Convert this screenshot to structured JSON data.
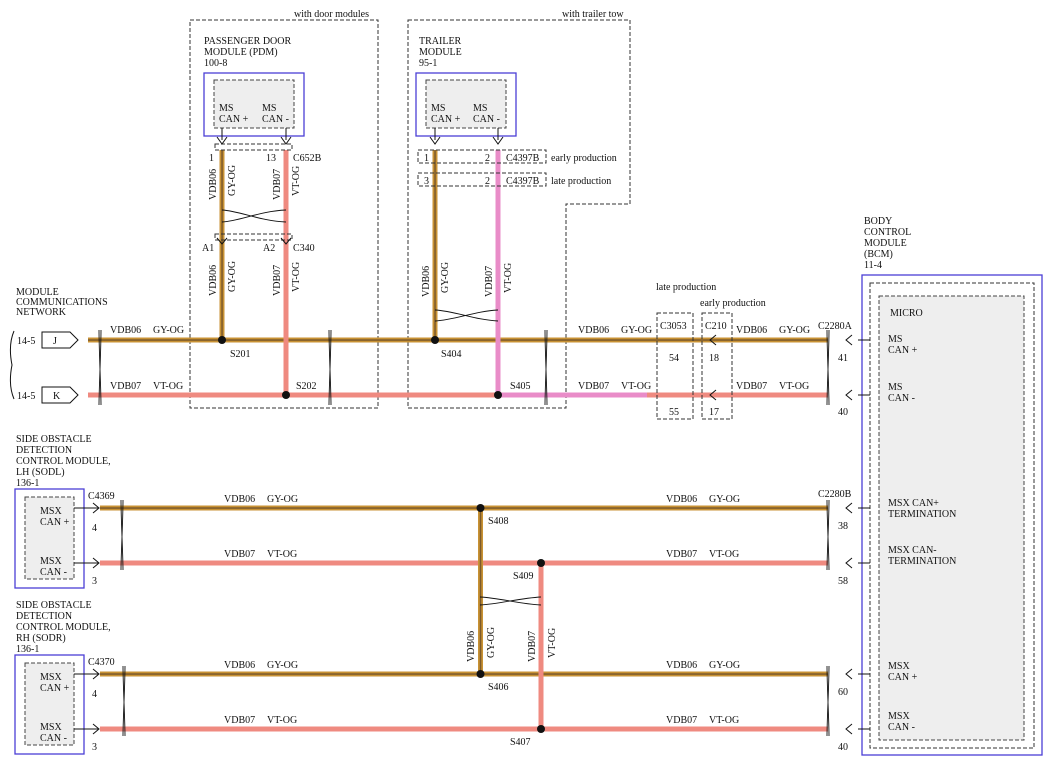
{
  "annotations": {
    "with_door_modules": "with door modules",
    "with_trailer_tow": "with trailer tow",
    "late_production": "late production",
    "early_production": "early production",
    "early_production_c4397b": "early production",
    "late_production_c4397b": "late production"
  },
  "network_label": [
    "MODULE",
    "COMMUNICATIONS",
    "NETWORK"
  ],
  "page_refs": {
    "j": "14-5",
    "k": "14-5"
  },
  "page_tags": {
    "j": "J",
    "k": "K"
  },
  "wire_labels": {
    "vdb06": "VDB06",
    "vdb07": "VDB07",
    "gy_og": "GY-OG",
    "vt_og": "VT-OG"
  },
  "modules": {
    "pdm": {
      "name_lines": [
        "PASSENGER DOOR",
        "MODULE (PDM)",
        "100-8"
      ],
      "ports": [
        {
          "label": [
            "MS",
            "CAN +"
          ]
        },
        {
          "label": [
            "MS",
            "CAN -"
          ]
        }
      ]
    },
    "trailer": {
      "name_lines": [
        "TRAILER",
        "MODULE",
        "95-1"
      ],
      "ports": [
        {
          "label": [
            "MS",
            "CAN +"
          ]
        },
        {
          "label": [
            "MS",
            "CAN -"
          ]
        }
      ]
    },
    "bcm": {
      "name_lines": [
        "BODY",
        "CONTROL",
        "MODULE",
        "(BCM)",
        "11-4"
      ],
      "micro": "MICRO",
      "ports": [
        {
          "label": [
            "MS",
            "CAN +"
          ]
        },
        {
          "label": [
            "MS",
            "CAN -"
          ]
        },
        {
          "label": [
            "MSX CAN+",
            "TERMINATION"
          ]
        },
        {
          "label": [
            "MSX CAN-",
            "TERMINATION"
          ]
        },
        {
          "label": [
            "MSX",
            "CAN +"
          ]
        },
        {
          "label": [
            "MSX",
            "CAN -"
          ]
        }
      ]
    },
    "sodl": {
      "name_lines": [
        "SIDE OBSTACLE",
        "DETECTION",
        "CONTROL MODULE,",
        "LH (SODL)",
        "136-1"
      ],
      "ports": [
        {
          "label": [
            "MSX",
            "CAN +"
          ]
        },
        {
          "label": [
            "MSX",
            "CAN -"
          ]
        }
      ]
    },
    "sodr": {
      "name_lines": [
        "SIDE OBSTACLE",
        "DETECTION",
        "CONTROL MODULE,",
        "RH (SODR)",
        "136-1"
      ],
      "ports": [
        {
          "label": [
            "MSX",
            "CAN +"
          ]
        },
        {
          "label": [
            "MSX",
            "CAN -"
          ]
        }
      ]
    }
  },
  "connectors": {
    "c652b": "C652B",
    "c340": "C340",
    "c4397b": "C4397B",
    "c3053": "C3053",
    "c210": "C210",
    "c2280a": "C2280A",
    "c2280b": "C2280B",
    "c4369": "C4369",
    "c4370": "C4370"
  },
  "pins": {
    "pdm_1": "1",
    "pdm_13": "13",
    "a1": "A1",
    "a2": "A2",
    "trl_1": "1",
    "trl_2": "2",
    "trl_3": "3",
    "trl_2b": "2",
    "c3053_54": "54",
    "c3053_55": "55",
    "c210_18": "18",
    "c210_17": "17",
    "bcm_41": "41",
    "bcm_40": "40",
    "bcm_38": "38",
    "bcm_58": "58",
    "bcm_60": "60",
    "bcm_40b": "40",
    "sodl_4": "4",
    "sodl_3": "3",
    "sodr_4": "4",
    "sodr_3": "3"
  },
  "splices": {
    "s201": "S201",
    "s202": "S202",
    "s404": "S404",
    "s405": "S405",
    "s406": "S406",
    "s407": "S407",
    "s408": "S408",
    "s409": "S409"
  },
  "colors": {
    "can_high_wire": "#c89234",
    "can_high_core": "#7c5a2c",
    "can_low_wire": "#ef8a80",
    "trailer_low_wire": "#e98cc8",
    "module_border": "#4b3fd6",
    "module_fill": "#eeeeee"
  }
}
